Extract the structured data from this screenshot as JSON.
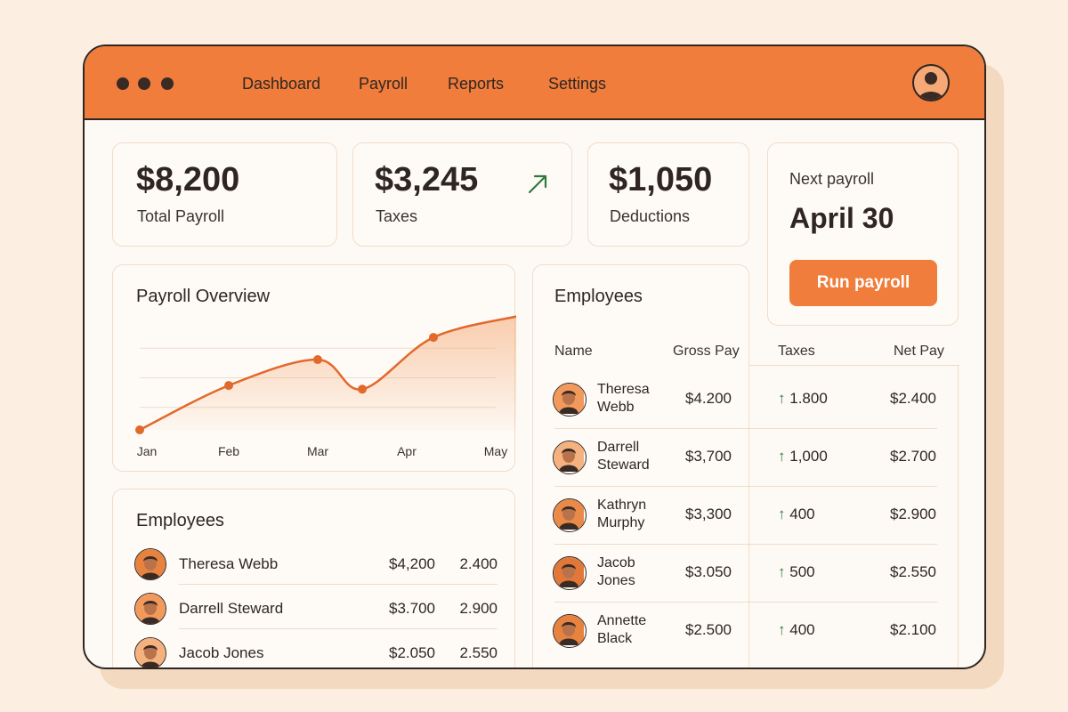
{
  "nav": {
    "items": [
      "Dashboard",
      "Payroll",
      "Reports",
      "Settings"
    ]
  },
  "stats": {
    "total_payroll": {
      "value": "$8,200",
      "label": "Total Payroll"
    },
    "taxes": {
      "value": "$3,245",
      "label": "Taxes",
      "trend_icon": "arrow-up-right-icon"
    },
    "deductions": {
      "value": "$1,050",
      "label": "Deductions"
    }
  },
  "next_payroll": {
    "label": "Next payroll",
    "date": "April 30",
    "button_label": "Run payroll"
  },
  "overview": {
    "title": "Payroll Overview",
    "chart_data": {
      "type": "line",
      "categories": [
        "Jan",
        "Feb",
        "Mar",
        "Apr",
        "May"
      ],
      "points": [
        {
          "x": 0.0,
          "y": 0.0
        },
        {
          "x": 1.0,
          "y": 0.6
        },
        {
          "x": 2.0,
          "y": 0.95
        },
        {
          "x": 2.5,
          "y": 0.55
        },
        {
          "x": 3.3,
          "y": 1.25
        },
        {
          "x": 4.3,
          "y": 1.55
        }
      ],
      "ylim": [
        0,
        1.6
      ],
      "grid": true
    }
  },
  "employees_small": {
    "title": "Employees",
    "rows": [
      {
        "name": "Theresa Webb",
        "gross": "$4,200",
        "net": "2.400"
      },
      {
        "name": "Darrell Steward",
        "gross": "$3.700",
        "net": "2.900"
      },
      {
        "name": "Jacob Jones",
        "gross": "$2.050",
        "net": "2.550"
      }
    ]
  },
  "employees_table": {
    "title": "Employees",
    "headers": {
      "name": "Name",
      "gross": "Gross Pay",
      "taxes": "Taxes",
      "net": "Net Pay"
    },
    "rows": [
      {
        "first": "Theresa",
        "last": "Webb",
        "gross": "$4.200",
        "taxes": "1.800",
        "net": "$2.400"
      },
      {
        "first": "Darrell",
        "last": "Steward",
        "gross": "$3,700",
        "taxes": "1,000",
        "net": "$2.700"
      },
      {
        "first": "Kathryn",
        "last": "Murphy",
        "gross": "$3,300",
        "taxes": "400",
        "net": "$2.900"
      },
      {
        "first": "Jacob",
        "last": "Jones",
        "gross": "$3.050",
        "taxes": "500",
        "net": "$2.550"
      },
      {
        "first": "Annette",
        "last": "Black",
        "gross": "$2.500",
        "taxes": "400",
        "net": "$2.100"
      }
    ]
  },
  "colors": {
    "accent": "#f07d3b",
    "positive": "#2f7a3b",
    "outline": "#2f2622",
    "background": "#fcefe2"
  }
}
